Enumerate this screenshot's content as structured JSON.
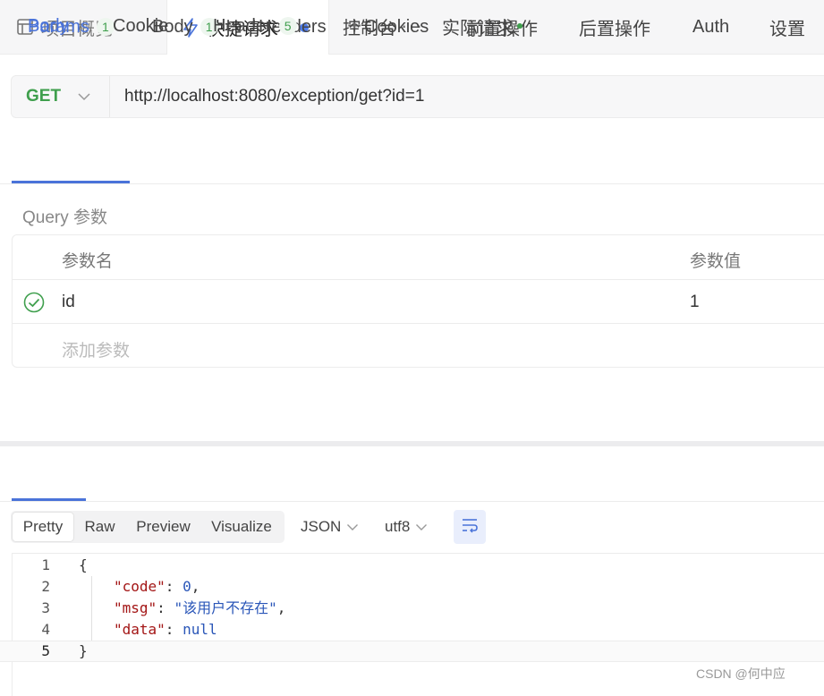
{
  "top_tabs": [
    {
      "label": "项目概览",
      "icon": "layout-icon"
    },
    {
      "label": "快捷请求",
      "icon": "lightning-icon",
      "unsaved": true
    }
  ],
  "top_actions": {
    "add": "+",
    "more": "···"
  },
  "request": {
    "method": "GET",
    "url": "http://localhost:8080/exception/get?id=1"
  },
  "request_tabs": [
    {
      "label": "Params",
      "badge": "1",
      "active": true
    },
    {
      "label": "Body",
      "badge": "1"
    },
    {
      "label": "Headers"
    },
    {
      "label": "Cookies"
    },
    {
      "label": "前置操作"
    },
    {
      "label": "后置操作"
    },
    {
      "label": "Auth"
    },
    {
      "label": "设置"
    }
  ],
  "query": {
    "section_label": "Query 参数",
    "headers": {
      "name": "参数名",
      "value": "参数值"
    },
    "rows": [
      {
        "name": "id",
        "value": "1",
        "enabled": true
      }
    ],
    "add_placeholder": "添加参数"
  },
  "response_tabs": [
    {
      "label": "Body",
      "active": true
    },
    {
      "label": "Cookie"
    },
    {
      "label": "Header",
      "badge": "5"
    },
    {
      "label": "控制台"
    },
    {
      "label": "实际请求",
      "dot": true
    }
  ],
  "format": {
    "modes": [
      "Pretty",
      "Raw",
      "Preview",
      "Visualize"
    ],
    "active_mode": "Pretty",
    "type": "JSON",
    "encoding": "utf8"
  },
  "code": {
    "line_numbers": [
      "1",
      "2",
      "3",
      "4",
      "5"
    ],
    "open_brace": "{",
    "close_brace": "}",
    "fields": [
      {
        "key": "\"code\"",
        "value": "0",
        "suffix": ","
      },
      {
        "key": "\"msg\"",
        "value": "\"该用户不存在\"",
        "suffix": ","
      },
      {
        "key": "\"data\"",
        "value": "null",
        "suffix": ""
      }
    ]
  },
  "watermark": "CSDN @何中应",
  "colors": {
    "accent": "#4a73d9",
    "get_method": "#3f9f4d",
    "badge_green": "#3f9f4d"
  }
}
